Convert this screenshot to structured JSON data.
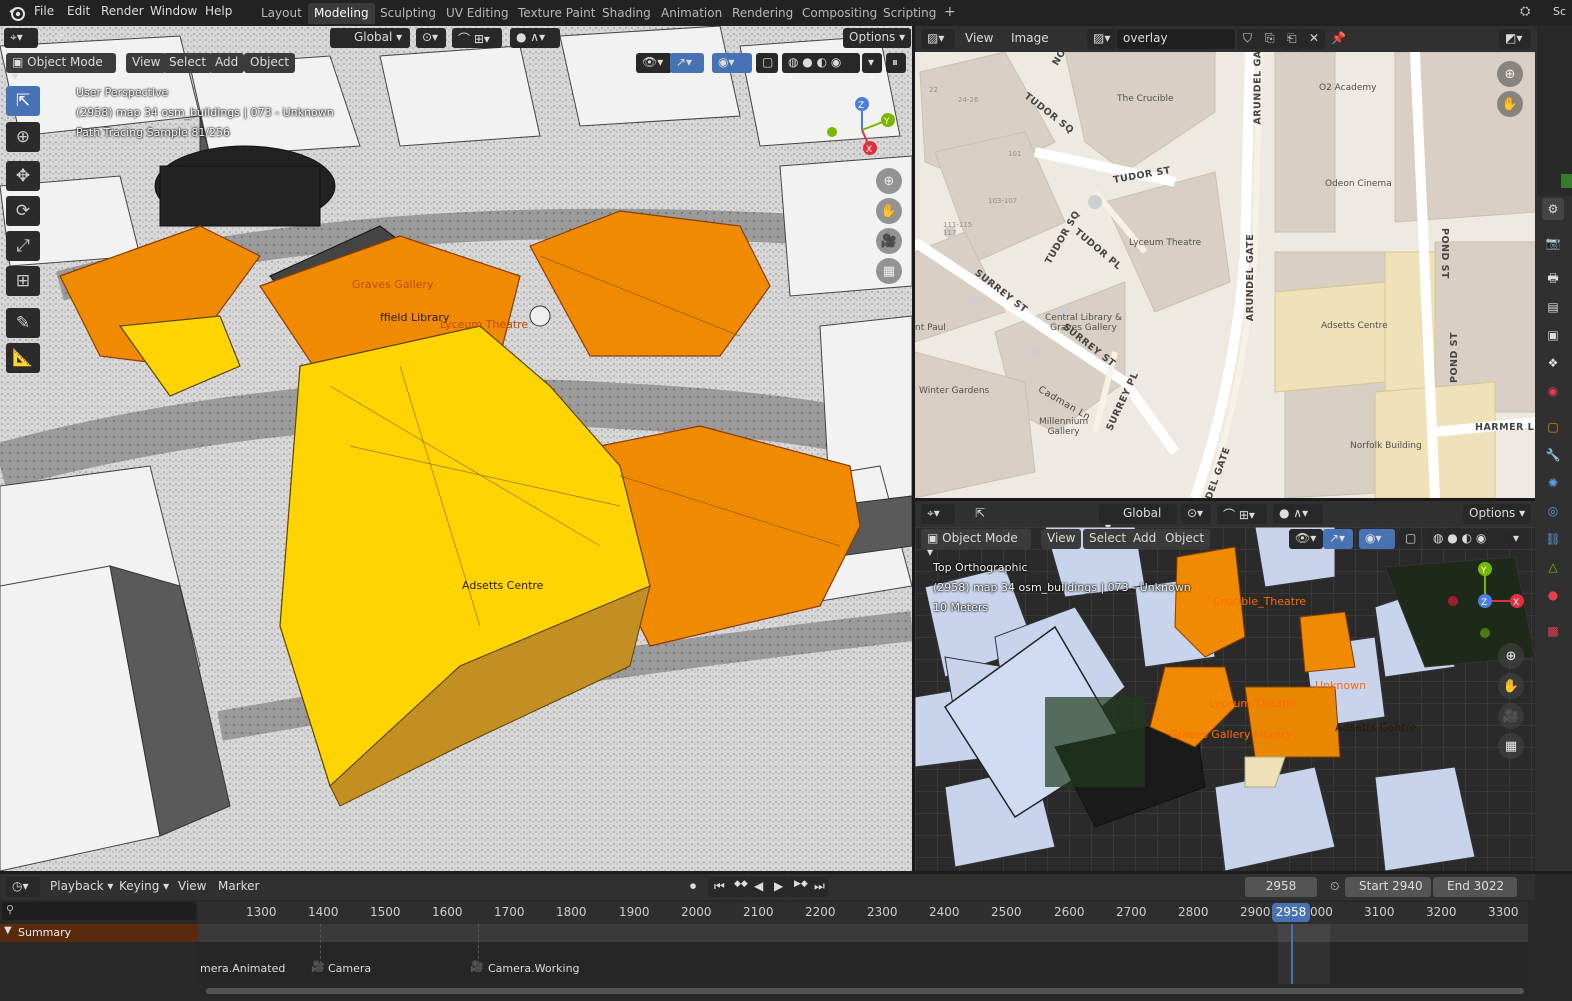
{
  "topbar": {
    "menus": [
      "File",
      "Edit",
      "Render",
      "Window",
      "Help"
    ],
    "workspaces": [
      "Layout",
      "Modeling",
      "Sculpting",
      "UV Editing",
      "Texture Paint",
      "Shading",
      "Animation",
      "Rendering",
      "Compositing",
      "Scripting"
    ],
    "active_workspace": "Modeling",
    "add_tab": "+",
    "right_label": "Sc"
  },
  "viewport3d": {
    "transform_orientation": "Global",
    "options_label": "Options",
    "mode": "Object Mode",
    "menu": [
      "View",
      "Select",
      "Add",
      "Object"
    ],
    "overlay_lines": [
      "User Perspective",
      "(2958) map 34 osm_buildings | 073 - Unknown",
      "Path Tracing Sample 81/256"
    ],
    "labels": {
      "graves_gallery": "Graves Gallery",
      "library": "ffield Library",
      "lyceum": "Lyceum Theatre",
      "adsetts": "Adsetts Centre"
    },
    "gizmo": {
      "z": "Z",
      "y": "Y",
      "x": "X"
    }
  },
  "image_editor": {
    "menu": [
      "View",
      "Image"
    ],
    "image_name": "overlay",
    "map_labels": {
      "crucible": "The Crucible",
      "o2": "O2 Academy",
      "odeon": "Odeon Cinema",
      "lyceum": "Lyceum Theatre",
      "library": "Central Library &\nGraves Gallery",
      "adsetts": "Adsetts Centre",
      "winter": "Winter Gardens",
      "millennium": "Millennium\nGallery",
      "norfolk": "Norfolk Building",
      "st_paul": "nt Paul",
      "house_101": "101",
      "house_103": "103-107",
      "house_111": "111-115\n117",
      "house_24": "24-26",
      "house_22": "22"
    },
    "streets": {
      "tudor_sq": "TUDOR SQ",
      "tudor_st": "TUDOR ST",
      "tudor_sq2": "TUDOR SQ",
      "tudor_pl": "TUDOR PL",
      "surrey_st": "SURREY ST",
      "surrey_st2": "SURREY ST",
      "surrey_pl": "SURREY PL",
      "cadman_ln": "Cadman Ln",
      "arundel_gate": "ARUNDEL GATE",
      "arundel_gate2": "ARUNDEL GATE",
      "arundel_gate3": "NDEL GATE",
      "arundel_ga": "ARUNDEL GA",
      "pond_st": "POND ST",
      "pond_st2": "POND ST",
      "harmer": "HARMER L",
      "no": "NO"
    }
  },
  "viewport_top": {
    "transform_orientation": "Global",
    "options_label": "Options",
    "mode": "Object Mode",
    "menu": [
      "View",
      "Select",
      "Add",
      "Object"
    ],
    "overlay_lines": [
      "Top Orthographic",
      "(2958) map 34 osm_buildings | 073 - Unknown",
      "10 Meters"
    ],
    "labels": {
      "crucible": "Crucible_Theatre",
      "unknown": "Unknown",
      "lyceum": "Lyceum Theatre",
      "graves": "Graves Gallery Library",
      "adsetts": "Adsetts Centre"
    },
    "gizmo": {
      "y": "Y",
      "z": "Z",
      "x": "X"
    }
  },
  "timeline": {
    "menu": [
      "Playback",
      "Keying",
      "View",
      "Marker"
    ],
    "current_frame": "2958",
    "start_label": "Start",
    "start_value": "2940",
    "end_label": "End",
    "end_value": "3022",
    "ticks": [
      "1300",
      "1400",
      "1500",
      "1600",
      "1700",
      "1800",
      "1900",
      "2000",
      "2100",
      "2200",
      "2300",
      "2400",
      "2500",
      "2600",
      "2700",
      "2800",
      "2900",
      "000",
      "3100",
      "3200",
      "3300"
    ],
    "playhead": "2958",
    "summary": "Summary",
    "markers": [
      "mera.Animated",
      "Camera",
      "Camera.Working"
    ],
    "transport": [
      "⏮",
      "◆◆",
      "◀",
      "▶",
      "▶◆",
      "⏭"
    ]
  },
  "colors": {
    "accent_blue": "#4772b3",
    "selected_orange": "#f08a00",
    "active_yellow": "#ffd400",
    "map_bg": "#ece6dd",
    "map_building": "#d9cfc4"
  }
}
